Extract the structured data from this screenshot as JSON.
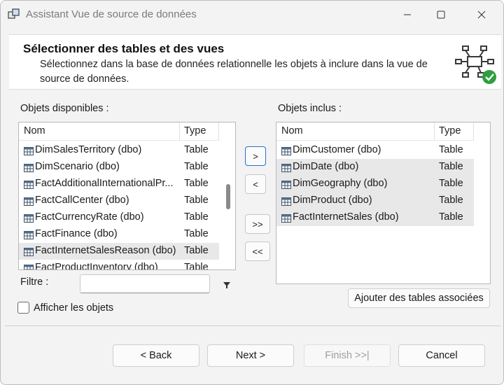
{
  "window": {
    "title": "Assistant Vue de source de données",
    "icon": "data-source-view-icon"
  },
  "header": {
    "title": "Sélectionner des tables et des vues",
    "description": "Sélectionnez dans la base de données relationnelle les objets à inclure dans la vue de source de données."
  },
  "available": {
    "label": "Objets disponibles :",
    "col_name": "Nom",
    "col_type": "Type",
    "rows": [
      {
        "name": "DimSalesTerritory (dbo)",
        "type": "Table"
      },
      {
        "name": "DimScenario (dbo)",
        "type": "Table"
      },
      {
        "name": "FactAdditionalInternationalPr...",
        "type": "Table"
      },
      {
        "name": "FactCallCenter (dbo)",
        "type": "Table"
      },
      {
        "name": "FactCurrencyRate (dbo)",
        "type": "Table"
      },
      {
        "name": "FactFinance (dbo)",
        "type": "Table"
      },
      {
        "name": "FactInternetSalesReason (dbo)",
        "type": "Table"
      },
      {
        "name": "FactProductInventory (dbo)",
        "type": "Table"
      }
    ],
    "selected_index": 6
  },
  "included": {
    "label": "Objets inclus :",
    "col_name": "Nom",
    "col_type": "Type",
    "rows": [
      {
        "name": "DimCustomer (dbo)",
        "type": "Table"
      },
      {
        "name": "DimDate (dbo)",
        "type": "Table"
      },
      {
        "name": "DimGeography (dbo)",
        "type": "Table"
      },
      {
        "name": "DimProduct (dbo)",
        "type": "Table"
      },
      {
        "name": "FactInternetSales (dbo)",
        "type": "Table"
      }
    ],
    "selected_indices": [
      1,
      2,
      3,
      4
    ]
  },
  "transfer": {
    "add": ">",
    "remove": "<",
    "add_all": ">>",
    "remove_all": "<<"
  },
  "filter": {
    "label": "Filtre :",
    "value": "",
    "icon": "filter-funnel-icon"
  },
  "show_objects": {
    "label": "Afficher les objets",
    "checked": false
  },
  "add_related_label": "Ajouter des tables associées",
  "footer": {
    "back": "< Back",
    "next": "Next >",
    "finish": "Finish >>|",
    "cancel": "Cancel"
  },
  "colors": {
    "selection": "#e8e8e8",
    "focus_border": "#2a6fd6",
    "check_green": "#2e9e3e"
  }
}
